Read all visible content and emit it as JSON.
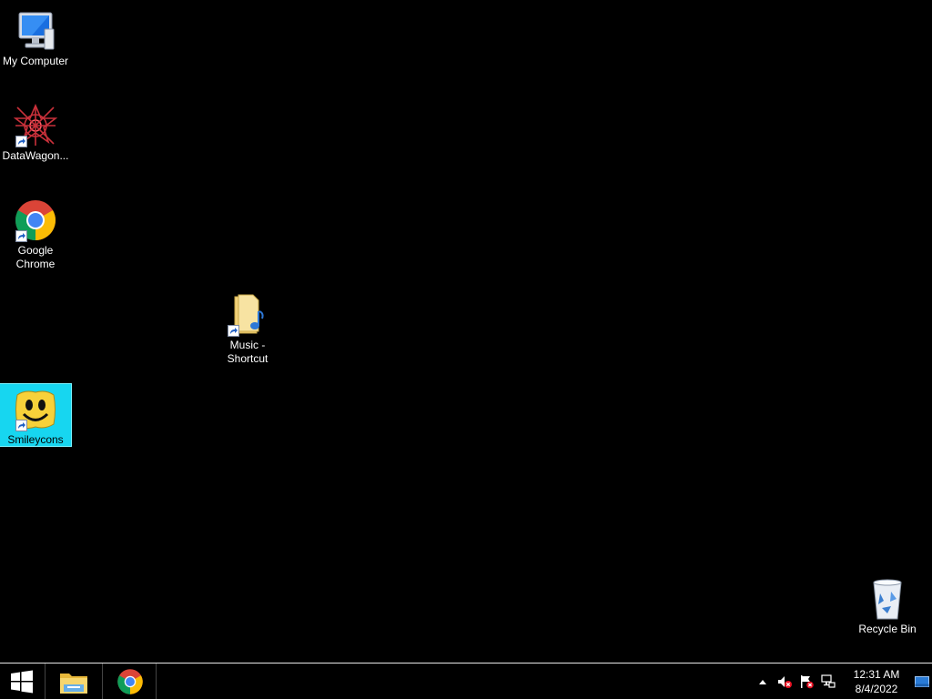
{
  "desktop": {
    "icons": [
      {
        "label": "My Computer",
        "icon": "computer-icon"
      },
      {
        "label": "DataWagon...",
        "icon": "datawagon-icon"
      },
      {
        "label": "Google\nChrome",
        "icon": "chrome-icon"
      },
      {
        "label": "Music -\nShortcut",
        "icon": "music-folder-icon"
      },
      {
        "label": "Smileycons",
        "icon": "smiley-icon"
      },
      {
        "label": "Recycle Bin",
        "icon": "recycle-bin-icon"
      }
    ]
  },
  "taskbar": {
    "start": "start-icon",
    "pinned": [
      "file-explorer-icon",
      "chrome-icon"
    ],
    "tray": {
      "icons": [
        "show-hidden-icons-icon",
        "volume-muted-icon",
        "action-center-flag-icon",
        "network-icon"
      ],
      "time": "12:31 AM",
      "date": "8/4/2022"
    }
  },
  "colors": {
    "desktop_bg": "#000000",
    "selection": "#17d6f0",
    "taskbar_border": "#e8e8e8"
  }
}
